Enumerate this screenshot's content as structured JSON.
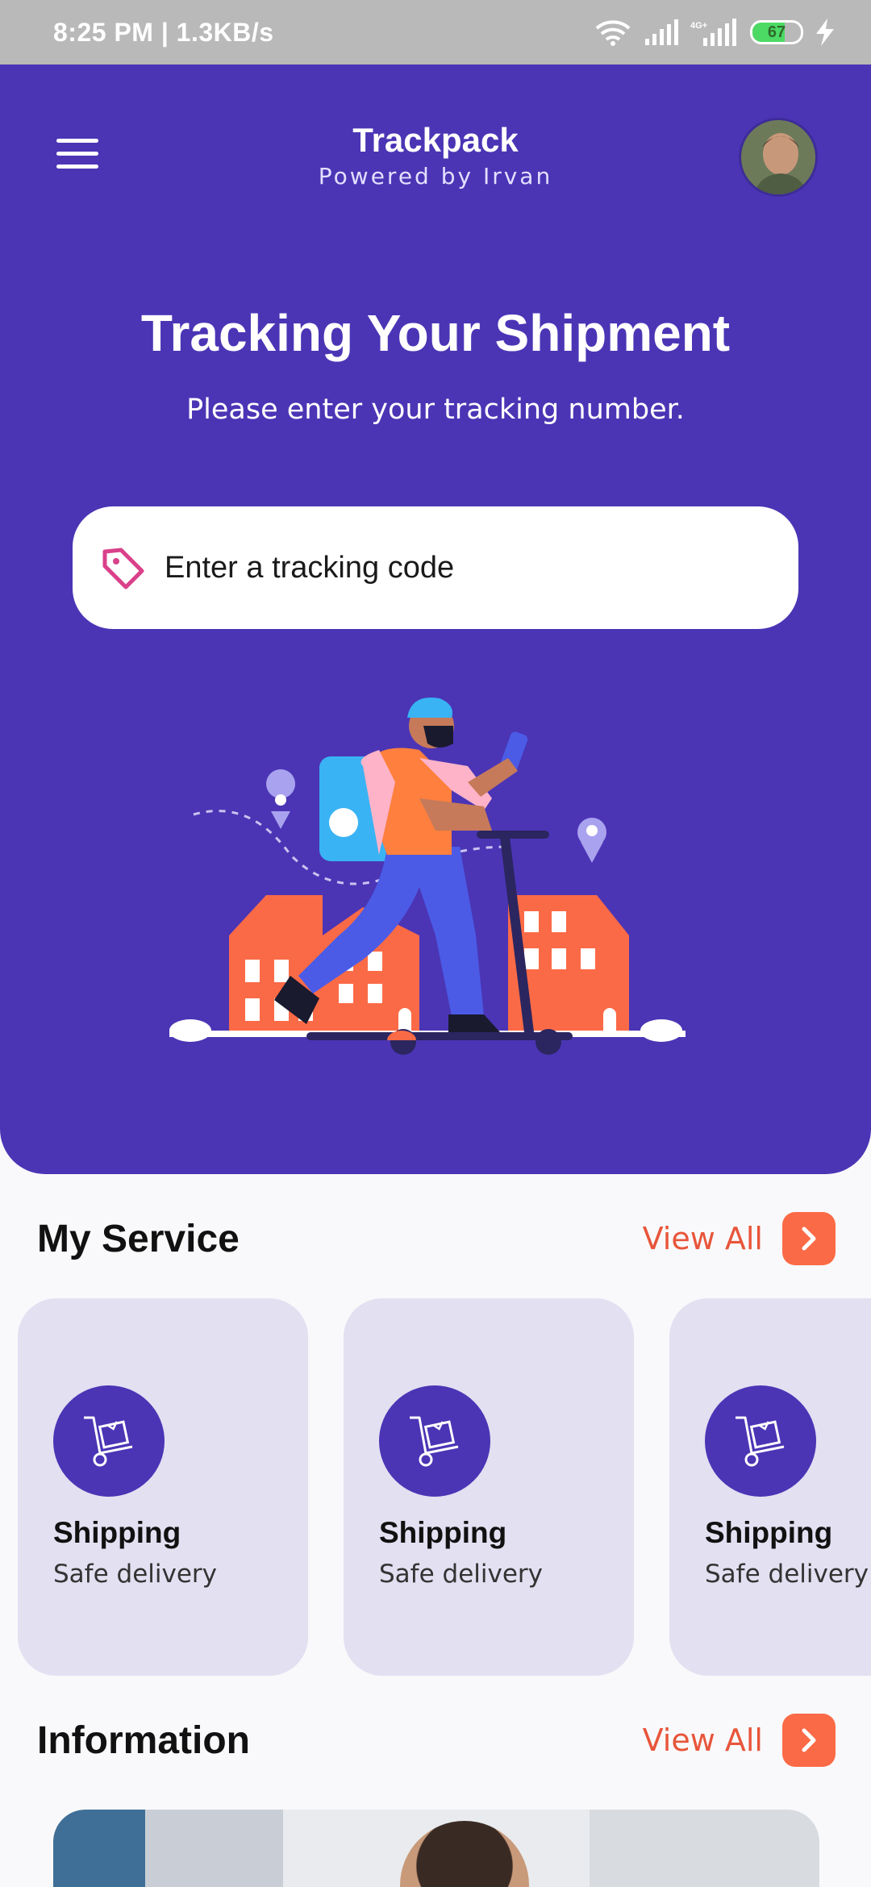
{
  "status_bar": {
    "text": "8:25 PM | 1.3KB/s",
    "battery": "67",
    "battery_level": 67
  },
  "header": {
    "app_name": "Trackpack",
    "tagline": "Powered by Irvan"
  },
  "hero": {
    "title": "Tracking Your Shipment",
    "subtitle": "Please enter your tracking number.",
    "search_placeholder": "Enter a tracking code"
  },
  "my_service": {
    "title": "My Service",
    "view_all": "View All",
    "cards": [
      {
        "title": "Shipping",
        "subtitle": "Safe delivery"
      },
      {
        "title": "Shipping",
        "subtitle": "Safe delivery"
      },
      {
        "title": "Shipping",
        "subtitle": "Safe delivery"
      }
    ]
  },
  "information": {
    "title": "Information",
    "view_all": "View All"
  },
  "colors": {
    "primary": "#4b35b5",
    "accent": "#fb6a46",
    "card_bg": "#e2e0f1",
    "link": "#e8553a"
  },
  "icons": [
    "wifi-icon",
    "signal-icon",
    "battery-icon",
    "charging-icon",
    "menu-icon",
    "tag-icon",
    "cart-icon",
    "chevron-right-icon"
  ]
}
